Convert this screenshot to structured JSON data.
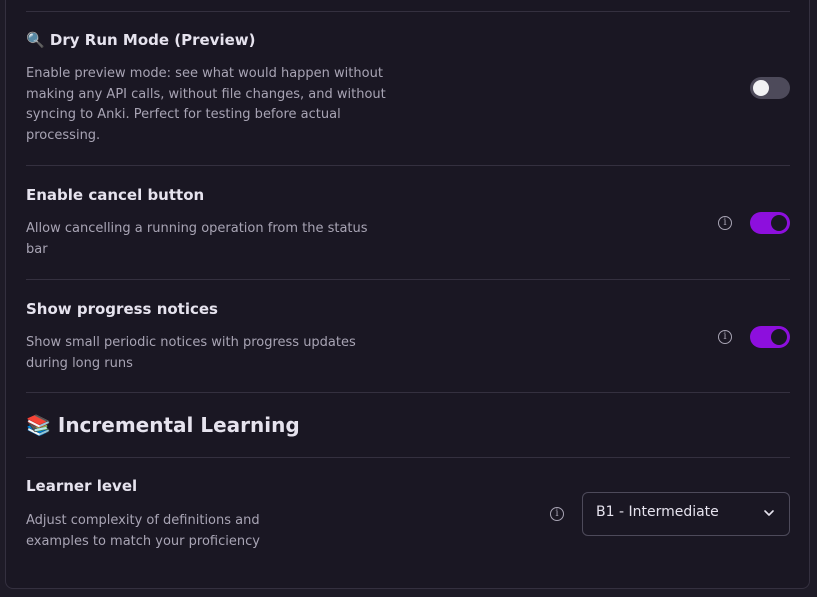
{
  "dry_run": {
    "icon": "magnifier-icon",
    "emoji": "🔍",
    "title": "Dry Run Mode (Preview)",
    "description_lines": [
      "Enable preview mode: see what would happen without",
      "making any API calls, without file changes, and without",
      "syncing to Anki. Perfect for testing before actual",
      "processing."
    ],
    "enabled": false
  },
  "cancel_button": {
    "title": "Enable cancel button",
    "description_lines": [
      "Allow cancelling a running operation from the status",
      "bar"
    ],
    "enabled": true
  },
  "progress_notices": {
    "title": "Show progress notices",
    "description_lines": [
      "Show small periodic notices with progress updates",
      "during long runs"
    ],
    "enabled": true
  },
  "incremental_learning": {
    "icon": "books-icon",
    "emoji": "📚",
    "heading": "Incremental Learning"
  },
  "learner_level": {
    "title": "Learner level",
    "description_lines": [
      "Adjust complexity of definitions and",
      "examples to match your proficiency"
    ],
    "selected": "B1 - Intermediate"
  },
  "colors": {
    "toggle_on": "#8d0fdd",
    "toggle_off": "#4d4a5a",
    "background": "#1a1723"
  }
}
